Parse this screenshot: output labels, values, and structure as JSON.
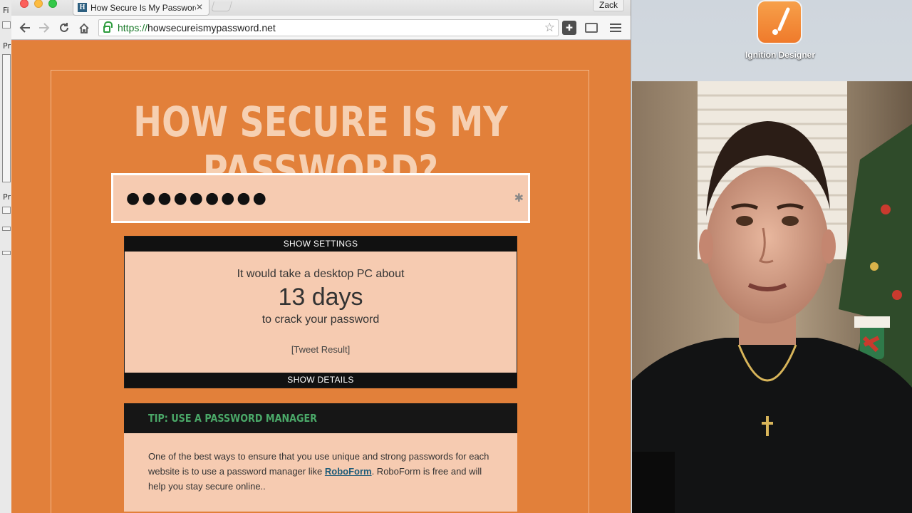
{
  "desktop": {
    "left_fragments": [
      "Fi",
      "Pr",
      "Pr"
    ],
    "app_icon": {
      "label": "Ignition Designer",
      "icon": "ignition-designer-icon"
    },
    "webcam": {
      "description_icon": "webcam-feed"
    }
  },
  "browser": {
    "tab": {
      "title": "How Secure Is My Password",
      "favicon_letter": "H"
    },
    "profile_name": "Zack",
    "url_scheme": "https://",
    "url_domain": "howsecureismypassword.net",
    "icons": {
      "back": "back-arrow-icon",
      "forward": "forward-arrow-icon",
      "reload": "reload-icon",
      "home": "home-icon",
      "bookmark": "star-icon",
      "extension": "puzzle-icon",
      "cast": "cast-icon",
      "menu": "hamburger-menu-icon"
    }
  },
  "page": {
    "headline": "HOW SECURE IS MY PASSWORD?",
    "password_dots": "●●●●●●●●●",
    "show_settings": "SHOW SETTINGS",
    "result": {
      "line1": "It would take a desktop PC about",
      "time": "13 days",
      "line3": "to crack your password",
      "tweet": "[Tweet Result]"
    },
    "show_details": "SHOW DETAILS",
    "tip": {
      "title": "TIP: USE A PASSWORD MANAGER",
      "body_before": "One of the best ways to ensure that you use unique and strong passwords for each website is to use a password manager like ",
      "link": "RoboForm",
      "body_after": ". RoboForm is free and will help you stay secure online.."
    }
  },
  "colors": {
    "page_bg": "#e2803a",
    "box_bg": "#f6cbb1",
    "bar_bg": "#111111",
    "tip_green": "#4aa868"
  }
}
